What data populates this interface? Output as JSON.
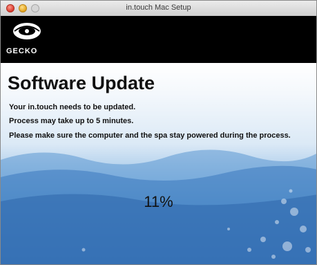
{
  "window": {
    "title": "in.touch Mac Setup"
  },
  "header": {
    "brand": "GECKO",
    "logo_icon": "gecko-logo-icon"
  },
  "content": {
    "heading": "Software Update",
    "lines": [
      "Your in.touch needs to be updated.",
      "Process may take up to 5 minutes.",
      "Please make sure the computer and the spa stay powered during the process."
    ],
    "progress_text": "11%",
    "progress_value": 0.11
  },
  "colors": {
    "header_bg": "#000000",
    "water_deep": "#3b7cc0",
    "water_light": "#dbe9f6"
  }
}
